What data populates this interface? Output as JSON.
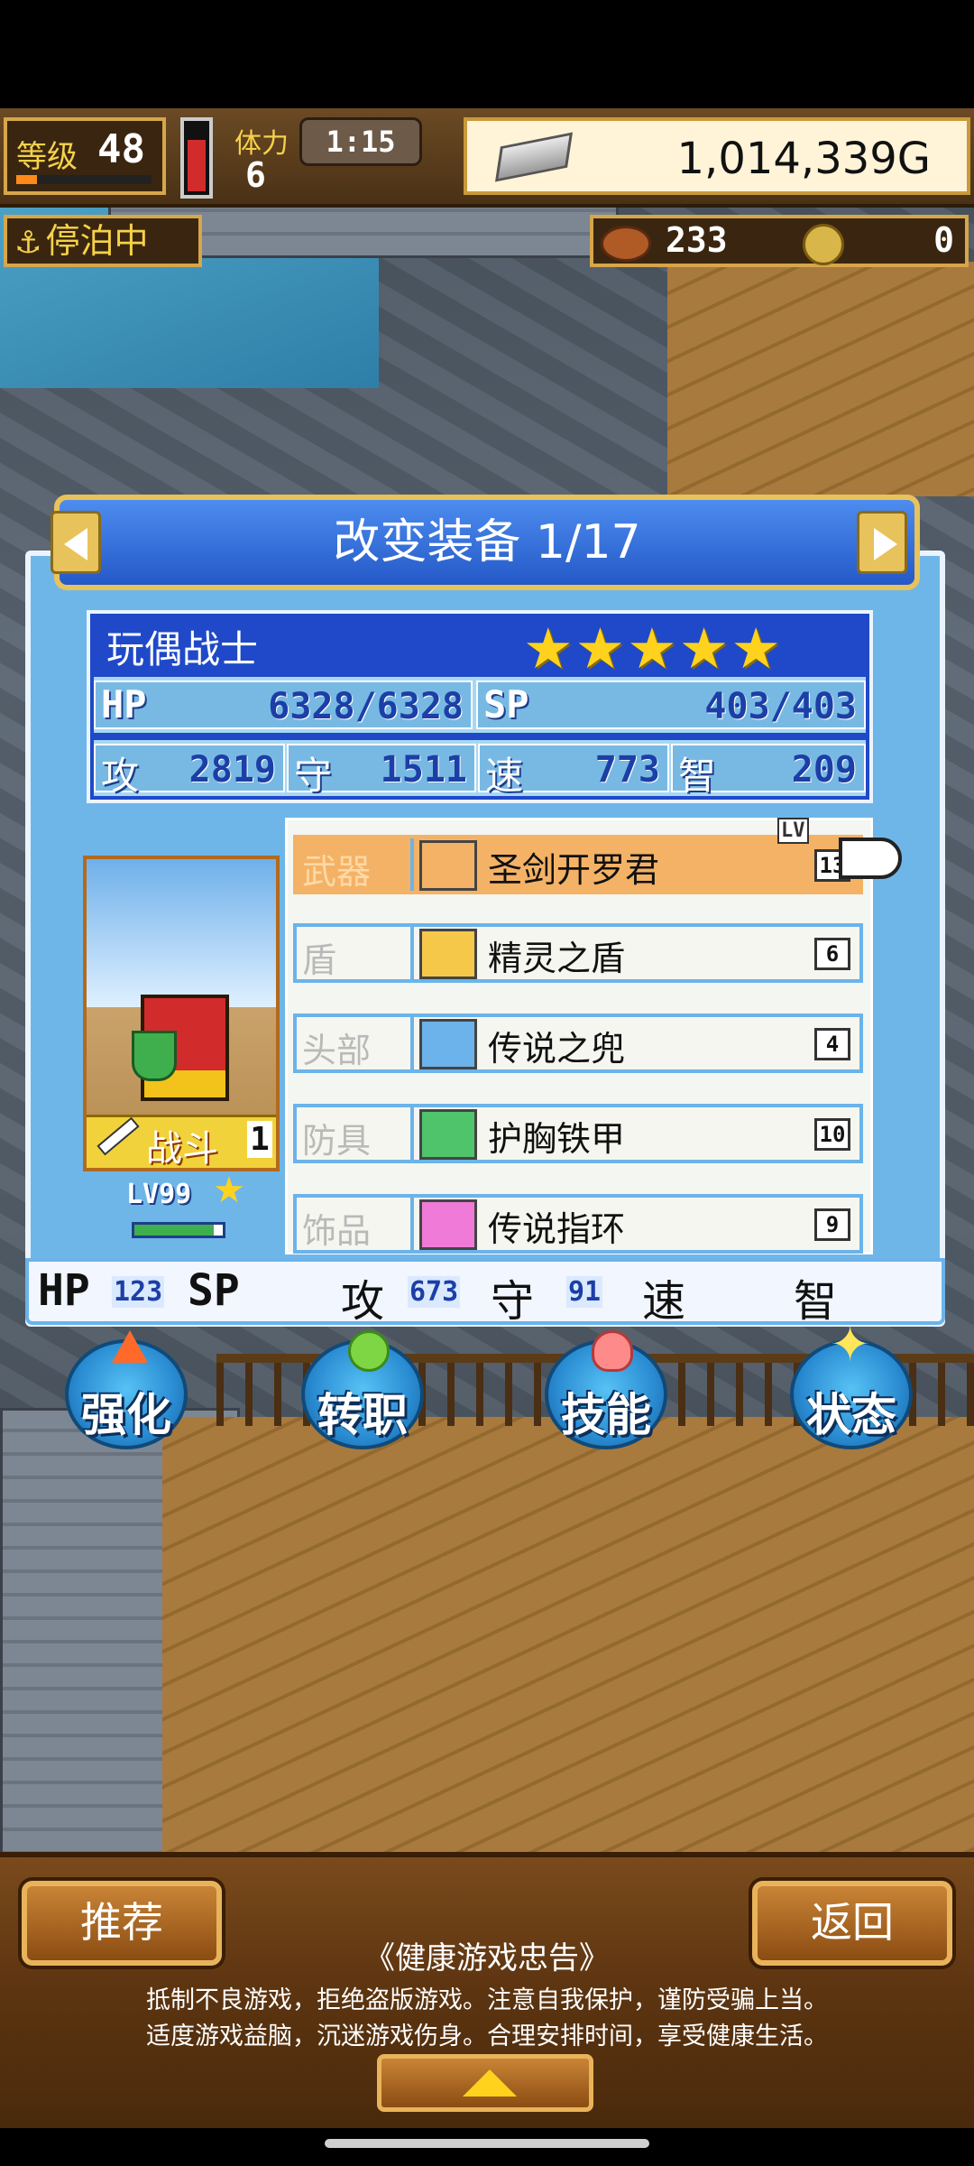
{
  "hud": {
    "level_label": "等级",
    "level": "48",
    "level_progress": 0.15,
    "stamina_label": "体力",
    "stamina": "6",
    "stamina_gauge": 0.7,
    "timer": "1:15",
    "gold": "1,014,339G",
    "moor_status": "停泊中",
    "food": "233",
    "medals": "0"
  },
  "panel": {
    "title": "改变装备 1/17",
    "character": {
      "name": "玩偶战士",
      "stars": "★★★★★",
      "hp_label": "HP",
      "hp": "6328/6328",
      "sp_label": "SP",
      "sp": "403/403",
      "atk_label": "攻",
      "atk": "2819",
      "def_label": "守",
      "def": "1511",
      "spd_label": "速",
      "spd": "773",
      "int_label": "智",
      "int": "209",
      "job": "战斗",
      "job_rank": "1",
      "level": "LV99",
      "exp_progress": 0.9
    },
    "equip_lv_label": "LV",
    "equipment": [
      {
        "slot": "武器",
        "name": "圣剑开罗君",
        "level": "13",
        "icon": "sword-icon",
        "icon_color": "#f4b266"
      },
      {
        "slot": "盾",
        "name": "精灵之盾",
        "level": "6",
        "icon": "shield-icon",
        "icon_color": "#f6c84a"
      },
      {
        "slot": "头部",
        "name": "传说之兜",
        "level": "4",
        "icon": "helmet-icon",
        "icon_color": "#6bb3ea"
      },
      {
        "slot": "防具",
        "name": "护胸铁甲",
        "level": "10",
        "icon": "armor-icon",
        "icon_color": "#4fc46a"
      },
      {
        "slot": "饰品",
        "name": "传说指环",
        "level": "9",
        "icon": "ring-icon",
        "icon_color": "#f07ad8"
      }
    ],
    "bonus": {
      "hp_label": "HP",
      "hp": "123",
      "sp_label": "SP",
      "atk_label": "攻",
      "atk": "673",
      "def_label": "守",
      "def": "91",
      "spd_label": "速",
      "int_label": "智"
    }
  },
  "actions": {
    "upgrade": "强化",
    "job_change": "转职",
    "skills": "技能",
    "status": "状态"
  },
  "bottom": {
    "recommend": "推荐",
    "back": "返回",
    "advice_title": "《健康游戏忠告》",
    "advice_line1": "抵制不良游戏，拒绝盗版游戏。注意自我保护，谨防受骗上当。",
    "advice_line2": "适度游戏益脑，沉迷游戏伤身。合理安排时间，享受健康生活。"
  }
}
